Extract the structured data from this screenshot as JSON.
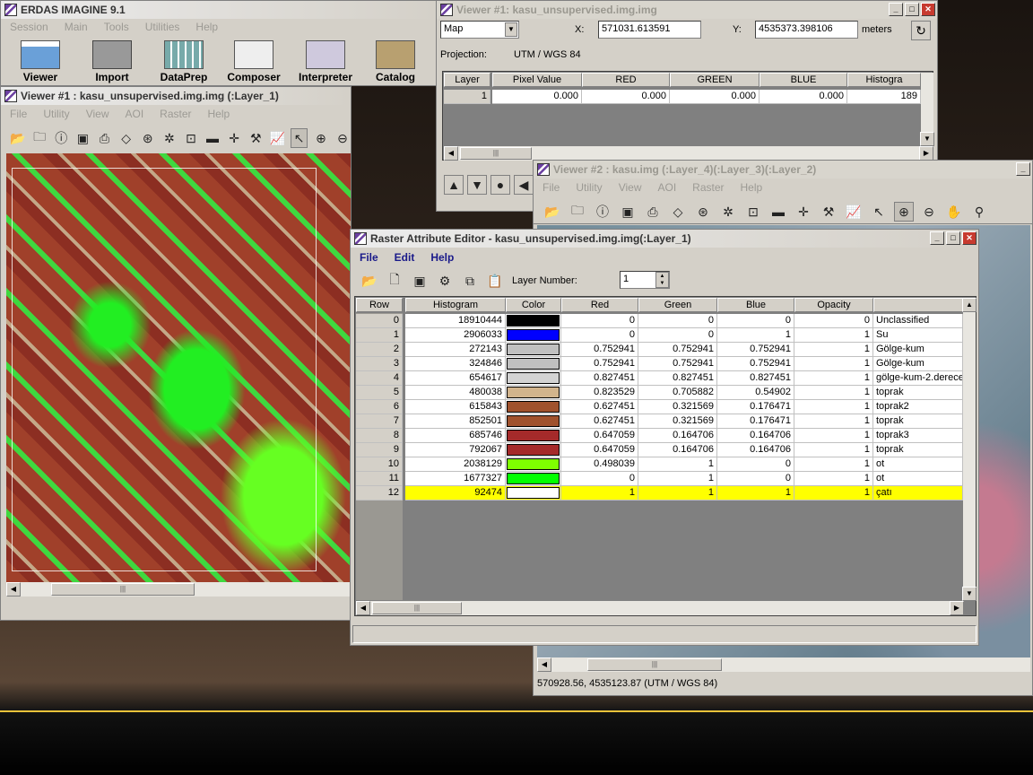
{
  "main": {
    "title": "ERDAS IMAGINE 9.1",
    "menus": [
      "Session",
      "Main",
      "Tools",
      "Utilities",
      "Help"
    ],
    "buttons": [
      "Viewer",
      "Import",
      "DataPrep",
      "Composer",
      "Interpreter",
      "Catalog"
    ]
  },
  "viewer1": {
    "title": "Viewer #1 : kasu_unsupervised.img.img (:Layer_1)",
    "menus": [
      "File",
      "Utility",
      "View",
      "AOI",
      "Raster",
      "Help"
    ]
  },
  "inquire": {
    "title": "Viewer #1:   kasu_unsupervised.img.img",
    "coord_type": "Map",
    "x_label": "X:",
    "x_value": "571031.613591",
    "y_label": "Y:",
    "y_value": "4535373.398106",
    "units": "meters",
    "projection_label": "Projection:",
    "projection": "UTM / WGS 84",
    "columns": [
      "Layer",
      "Pixel Value",
      "RED",
      "GREEN",
      "BLUE",
      "Histogra"
    ],
    "row": [
      "1",
      "0.000",
      "0.000",
      "0.000",
      "0.000",
      "189"
    ]
  },
  "viewer2": {
    "title": "Viewer #2 : kasu.img (:Layer_4)(:Layer_3)(:Layer_2)",
    "menus": [
      "File",
      "Utility",
      "View",
      "AOI",
      "Raster",
      "Help"
    ],
    "status": "570928.56, 4535123.87  (UTM / WGS 84)"
  },
  "rae": {
    "title": "Raster Attribute Editor - kasu_unsupervised.img.img(:Layer_1)",
    "menus": [
      "File",
      "Edit",
      "Help"
    ],
    "layer_number_label": "Layer Number:",
    "layer_number": "1",
    "columns": [
      "Row",
      "Histogram",
      "Color",
      "Red",
      "Green",
      "Blue",
      "Opacity"
    ],
    "rows": [
      {
        "row": "0",
        "hist": "18910444",
        "color": "#000000",
        "red": "0",
        "green": "0",
        "blue": "0",
        "opacity": "0",
        "name": "Unclassified"
      },
      {
        "row": "1",
        "hist": "2906033",
        "color": "#0000ff",
        "red": "0",
        "green": "0",
        "blue": "1",
        "opacity": "1",
        "name": "Su"
      },
      {
        "row": "2",
        "hist": "272143",
        "color": "#c0c0c0",
        "red": "0.752941",
        "green": "0.752941",
        "blue": "0.752941",
        "opacity": "1",
        "name": "Gölge-kum"
      },
      {
        "row": "3",
        "hist": "324846",
        "color": "#c0c0c0",
        "red": "0.752941",
        "green": "0.752941",
        "blue": "0.752941",
        "opacity": "1",
        "name": "Gölge-kum"
      },
      {
        "row": "4",
        "hist": "654617",
        "color": "#d3d3d3",
        "red": "0.827451",
        "green": "0.827451",
        "blue": "0.827451",
        "opacity": "1",
        "name": "gölge-kum-2.derece"
      },
      {
        "row": "5",
        "hist": "480038",
        "color": "#d2b48c",
        "red": "0.823529",
        "green": "0.705882",
        "blue": "0.54902",
        "opacity": "1",
        "name": "toprak"
      },
      {
        "row": "6",
        "hist": "615843",
        "color": "#a0522d",
        "red": "0.627451",
        "green": "0.321569",
        "blue": "0.176471",
        "opacity": "1",
        "name": "toprak2"
      },
      {
        "row": "7",
        "hist": "852501",
        "color": "#a0522d",
        "red": "0.627451",
        "green": "0.321569",
        "blue": "0.176471",
        "opacity": "1",
        "name": "toprak"
      },
      {
        "row": "8",
        "hist": "685746",
        "color": "#a52a2a",
        "red": "0.647059",
        "green": "0.164706",
        "blue": "0.164706",
        "opacity": "1",
        "name": "toprak3"
      },
      {
        "row": "9",
        "hist": "792067",
        "color": "#a52a2a",
        "red": "0.647059",
        "green": "0.164706",
        "blue": "0.164706",
        "opacity": "1",
        "name": "toprak"
      },
      {
        "row": "10",
        "hist": "2038129",
        "color": "#7fff00",
        "red": "0.498039",
        "green": "1",
        "blue": "0",
        "opacity": "1",
        "name": "ot"
      },
      {
        "row": "11",
        "hist": "1677327",
        "color": "#00ff00",
        "red": "0",
        "green": "1",
        "blue": "0",
        "opacity": "1",
        "name": "ot"
      },
      {
        "row": "12",
        "hist": "92474",
        "color": "#ffffff",
        "red": "1",
        "green": "1",
        "blue": "1",
        "opacity": "1",
        "name": "çatı"
      }
    ]
  }
}
